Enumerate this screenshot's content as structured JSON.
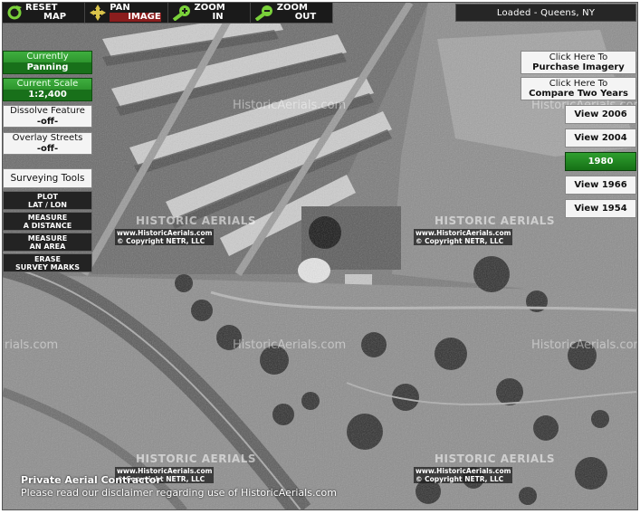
{
  "toolbar": {
    "reset": {
      "line1": "RESET",
      "line2": "MAP",
      "icon": "reset-icon"
    },
    "pan": {
      "line1": "PAN",
      "line2": "IMAGE",
      "icon": "pan-arrows-icon"
    },
    "zoom_in": {
      "line1": "ZOOM",
      "line2": "IN",
      "icon": "zoom-in-magnifier-icon"
    },
    "zoom_out": {
      "line1": "ZOOM",
      "line2": "OUT",
      "icon": "zoom-out-magnifier-icon"
    }
  },
  "loaded": "Loaded - Queens, NY",
  "left_panel": {
    "mode": {
      "label": "Currently",
      "value": "Panning"
    },
    "scale": {
      "label": "Current Scale",
      "value": "1:2,400"
    },
    "dissolve": {
      "label": "Dissolve Feature",
      "value": "-off-"
    },
    "overlay": {
      "label": "Overlay Streets",
      "value": "-off-"
    },
    "surveying_title": "Surveying Tools",
    "tools": [
      {
        "line1": "PLOT",
        "line2": "LAT / LON"
      },
      {
        "line1": "MEASURE",
        "line2": "A DISTANCE"
      },
      {
        "line1": "MEASURE",
        "line2": "AN AREA"
      },
      {
        "line1": "ERASE",
        "line2": "SURVEY MARKS"
      }
    ]
  },
  "right_panel": {
    "purchase": {
      "line1": "Click Here To",
      "line2": "Purchase Imagery"
    },
    "compare": {
      "line1": "Click Here To",
      "line2": "Compare Two Years"
    },
    "years": [
      {
        "label": "View 2006",
        "active": false
      },
      {
        "label": "View 2004",
        "active": false
      },
      {
        "label": "1980",
        "active": true
      },
      {
        "label": "View 1966",
        "active": false
      },
      {
        "label": "View 1954",
        "active": false
      }
    ]
  },
  "watermarks": {
    "brand": "HISTORIC AERIALS",
    "site": "www.HistoricAerials.com",
    "copyright": "© Copyright NETR, LLC",
    "faint": "HistoricAerials.com",
    "faint_cut": "rials.com"
  },
  "footer": {
    "line1": "Private Aerial Contractor",
    "line2": "Please read our disclaimer regarding use of HistoricAerials.com"
  },
  "colors": {
    "accent_green": "#1c7d1c",
    "toolbar_bg": "#1a1a1a"
  }
}
